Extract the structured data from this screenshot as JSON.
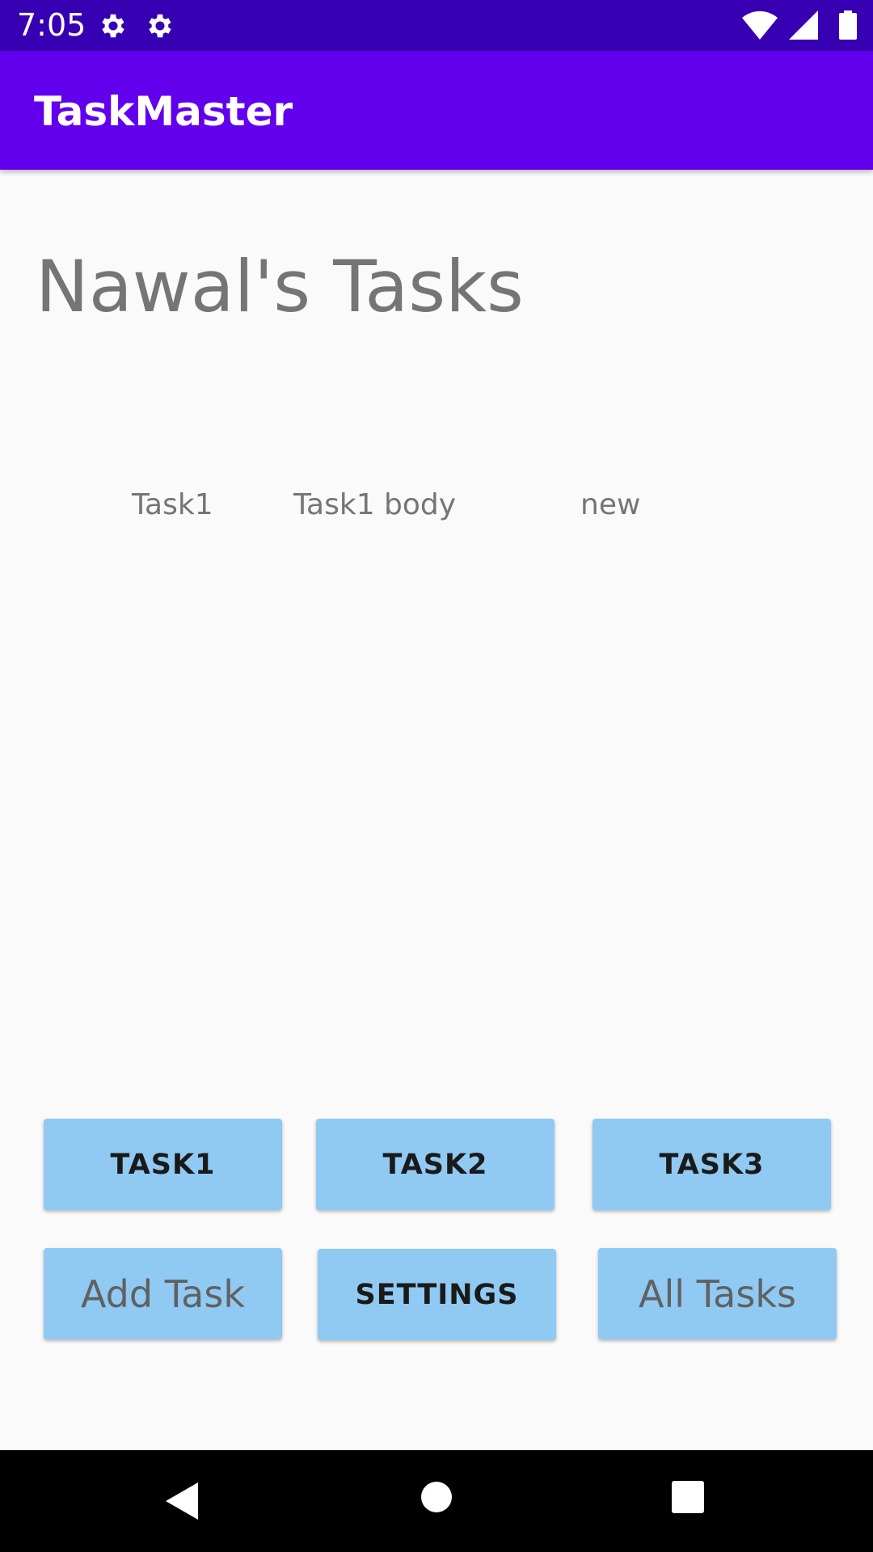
{
  "status_bar": {
    "time": "7:05",
    "icons": [
      "gear-icon",
      "gear-icon",
      "wifi-icon",
      "signal-icon",
      "battery-icon"
    ],
    "background": "#3700b3"
  },
  "app_bar": {
    "title": "TaskMaster",
    "background": "#6200ee"
  },
  "main": {
    "heading": "Nawal's Tasks",
    "tasks": [
      {
        "title": "Task1",
        "body": "Task1 body",
        "state": "new"
      }
    ]
  },
  "buttons": {
    "task1": "TASK1",
    "task2": "TASK2",
    "task3": "TASK3",
    "add_task": "Add Task",
    "settings": "SETTINGS",
    "all_tasks": "All Tasks",
    "background": "#90caf3"
  },
  "nav_bar": {
    "icons": [
      "back-icon",
      "home-icon",
      "recents-icon"
    ]
  }
}
